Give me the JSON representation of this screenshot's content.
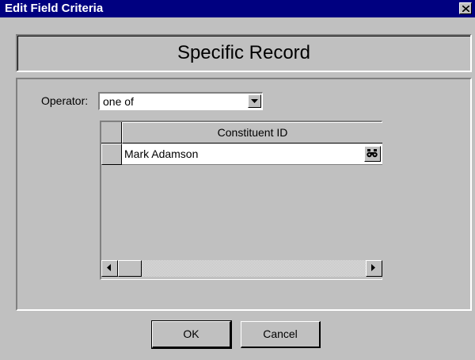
{
  "window": {
    "title": "Edit Field Criteria",
    "close_glyph": "close-icon"
  },
  "header": {
    "title": "Specific Record"
  },
  "operator": {
    "label": "Operator:",
    "value": "one of"
  },
  "grid": {
    "column_header": "Constituent ID",
    "rows": [
      {
        "value": "Mark Adamson",
        "lookup_icon": "binoculars-icon"
      }
    ]
  },
  "buttons": {
    "ok_label": "OK",
    "cancel_label": "Cancel"
  }
}
